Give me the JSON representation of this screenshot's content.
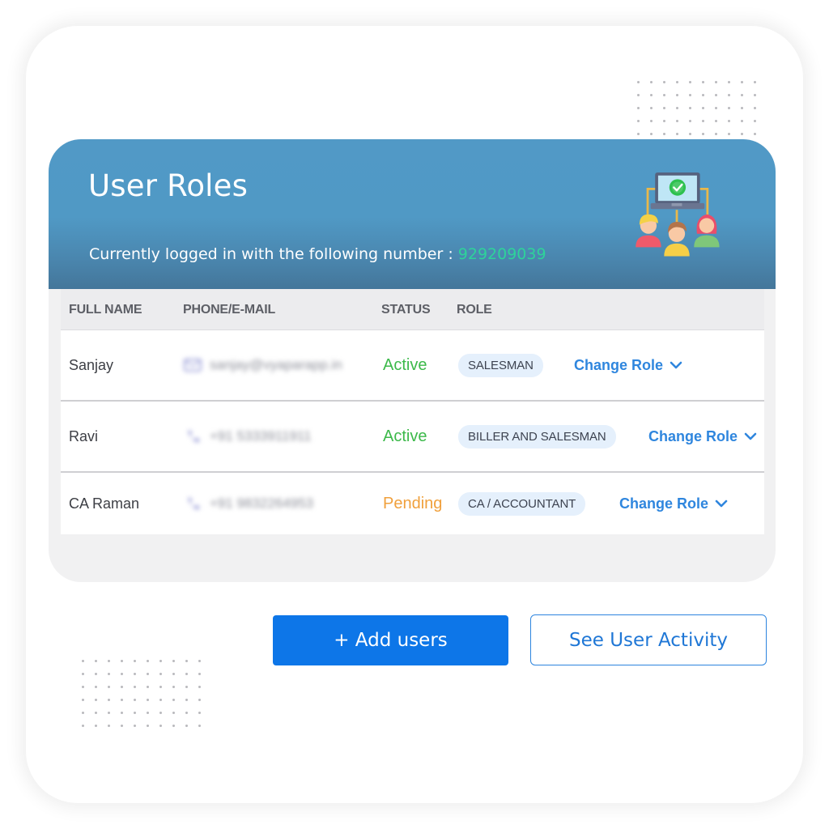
{
  "page": {
    "title": "User Roles",
    "logged_in_label": "Currently logged in with the following number : ",
    "logged_in_number": "929209039"
  },
  "illustration": {
    "icon": "users-network-icon",
    "description": "laptop with check mark connected to three users"
  },
  "table": {
    "columns": [
      "FULL NAME",
      "PHONE/E-MAIL",
      "STATUS",
      "ROLE"
    ],
    "rows": [
      {
        "name": "Sanjay",
        "contact_icon": "mail-icon",
        "contact": "sanjay@vyaparapp.in",
        "contact_blurred": true,
        "status": "Active",
        "role": "SALESMAN",
        "action": "Change Role"
      },
      {
        "name": "Ravi",
        "contact_icon": "phone-icon",
        "contact": "+91 5333911911",
        "contact_blurred": true,
        "status": "Active",
        "role": "BILLER AND SALESMAN",
        "action": "Change Role"
      },
      {
        "name": "CA Raman",
        "contact_icon": "phone-icon",
        "contact": "+91 9832264953",
        "contact_blurred": true,
        "status": "Pending",
        "role": "CA / ACCOUNTANT",
        "action": "Change Role"
      }
    ]
  },
  "buttons": {
    "add_users": "+ Add users",
    "see_activity": "See User Activity"
  },
  "colors": {
    "header_blue": "#5199c6",
    "primary_button": "#0d76e8",
    "link_blue": "#2f86de",
    "status_active": "#3cb94a",
    "status_pending": "#f0a03c",
    "number_green": "#2ed39a",
    "role_badge_bg": "#e5f0fc"
  }
}
